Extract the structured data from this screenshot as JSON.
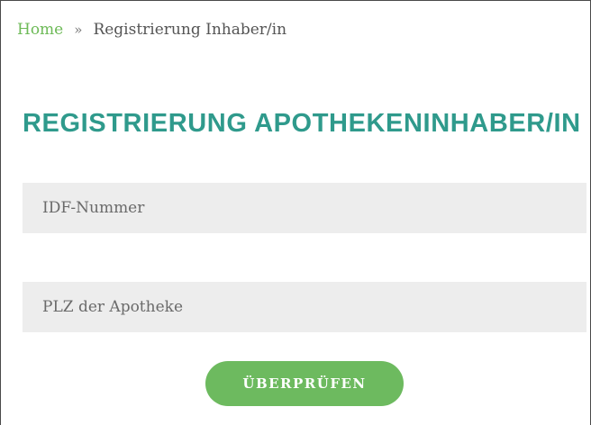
{
  "breadcrumb": {
    "home_label": "Home",
    "separator": "»",
    "current_label": "Registrierung Inhaber/in"
  },
  "page": {
    "title": "REGISTRIERUNG APOTHEKENINHABER/IN"
  },
  "form": {
    "idf_placeholder": "IDF-Nummer",
    "idf_value": "",
    "plz_placeholder": "PLZ der Apotheke",
    "plz_value": "",
    "submit_label": "ÜBERPRÜFEN"
  },
  "colors": {
    "accent_link": "#6dba57",
    "title": "#2f9a8c",
    "button": "#6dba5f",
    "field_bg": "#ededed"
  }
}
